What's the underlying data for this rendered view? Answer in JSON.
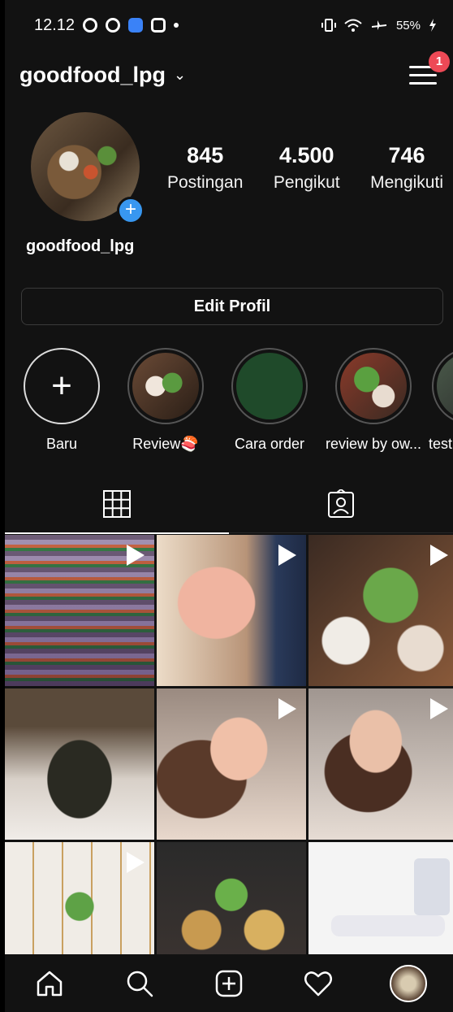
{
  "status_bar": {
    "time": "12.12",
    "battery": "55%"
  },
  "header": {
    "username": "goodfood_lpg",
    "notification_count": "1"
  },
  "profile": {
    "name": "goodfood_lpg",
    "stats": [
      {
        "value": "845",
        "label": "Postingan"
      },
      {
        "value": "4.500",
        "label": "Pengikut"
      },
      {
        "value": "746",
        "label": "Mengikuti"
      }
    ],
    "edit_label": "Edit Profil"
  },
  "highlights": [
    {
      "label": "Baru"
    },
    {
      "label": "Review🍣"
    },
    {
      "label": "Cara order"
    },
    {
      "label": "review by ow..."
    },
    {
      "label": "testi"
    }
  ],
  "tabs": [
    "grid-icon",
    "tagged-icon"
  ],
  "grid": {
    "posts": 9,
    "video_posts": [
      1,
      2,
      3,
      5,
      6,
      7
    ]
  },
  "nav": [
    "home-icon",
    "search-icon",
    "add-post-icon",
    "heart-icon",
    "profile-avatar"
  ],
  "colors": {
    "background": "#121212",
    "badge": "#ed4956",
    "accent": "#3897f0"
  }
}
